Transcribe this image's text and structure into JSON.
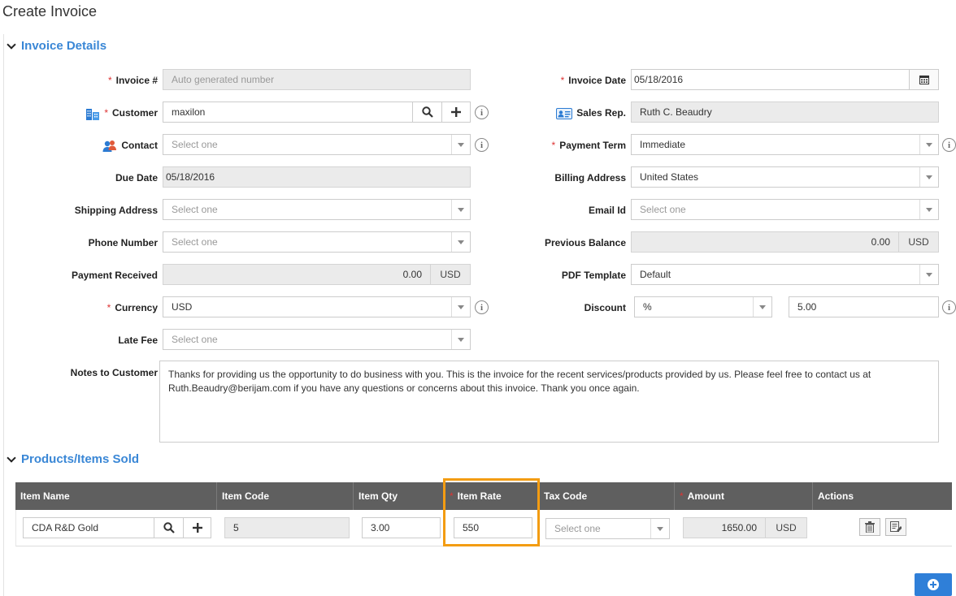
{
  "page": {
    "title": "Create Invoice"
  },
  "invoice_details": {
    "heading": "Invoice Details",
    "invoice_no": {
      "label": "Invoice #",
      "placeholder": "Auto generated number"
    },
    "customer": {
      "label": "Customer",
      "value": "maxilon"
    },
    "contact": {
      "label": "Contact",
      "placeholder": "Select one"
    },
    "due_date": {
      "label": "Due Date",
      "value": "05/18/2016"
    },
    "shipping_address": {
      "label": "Shipping Address",
      "placeholder": "Select one"
    },
    "phone_number": {
      "label": "Phone Number",
      "placeholder": "Select one"
    },
    "payment_received": {
      "label": "Payment Received",
      "value": "0.00",
      "currency": "USD"
    },
    "currency": {
      "label": "Currency",
      "value": "USD"
    },
    "late_fee": {
      "label": "Late Fee",
      "placeholder": "Select one"
    },
    "invoice_date": {
      "label": "Invoice Date",
      "value": "05/18/2016"
    },
    "sales_rep": {
      "label": "Sales Rep.",
      "value": "Ruth C. Beaudry"
    },
    "payment_term": {
      "label": "Payment Term",
      "value": "Immediate"
    },
    "billing_address": {
      "label": "Billing Address",
      "value": "United States"
    },
    "email_id": {
      "label": "Email Id",
      "placeholder": "Select one"
    },
    "previous_balance": {
      "label": "Previous Balance",
      "value": "0.00",
      "currency": "USD"
    },
    "pdf_template": {
      "label": "PDF Template",
      "value": "Default"
    },
    "discount": {
      "label": "Discount",
      "type": "%",
      "value": "5.00"
    },
    "notes": {
      "label": "Notes to Customer",
      "value": "Thanks for providing us the opportunity to do business with you. This is the invoice for the recent services/products provided by us. Please feel free to contact us at Ruth.Beaudry@berijam.com if you have any questions or concerns about this invoice. Thank you once again."
    }
  },
  "products": {
    "heading": "Products/Items Sold",
    "columns": [
      "Item Name",
      "Item Code",
      "Item Qty",
      "Item Rate",
      "Tax Code",
      "Amount",
      "Actions"
    ],
    "row": {
      "item_name": "CDA R&D Gold",
      "item_code": "5",
      "item_qty": "3.00",
      "item_rate": "550",
      "tax_code_placeholder": "Select one",
      "amount": "1650.00",
      "amount_currency": "USD"
    }
  },
  "icons": {
    "search": "search-icon",
    "plus": "plus-icon",
    "info": "info-icon",
    "calendar": "calendar-icon",
    "building": "building-icon",
    "contacts": "contacts-icon",
    "id_card": "id-card-icon",
    "trash": "trash-icon",
    "edit": "edit-icon",
    "add_circle": "add-circle-icon"
  },
  "colors": {
    "accent": "#3a87d6",
    "required": "#dd3333",
    "highlight": "#f39c12",
    "table_header": "#5f5f5f",
    "add_button": "#2f7fd8"
  }
}
